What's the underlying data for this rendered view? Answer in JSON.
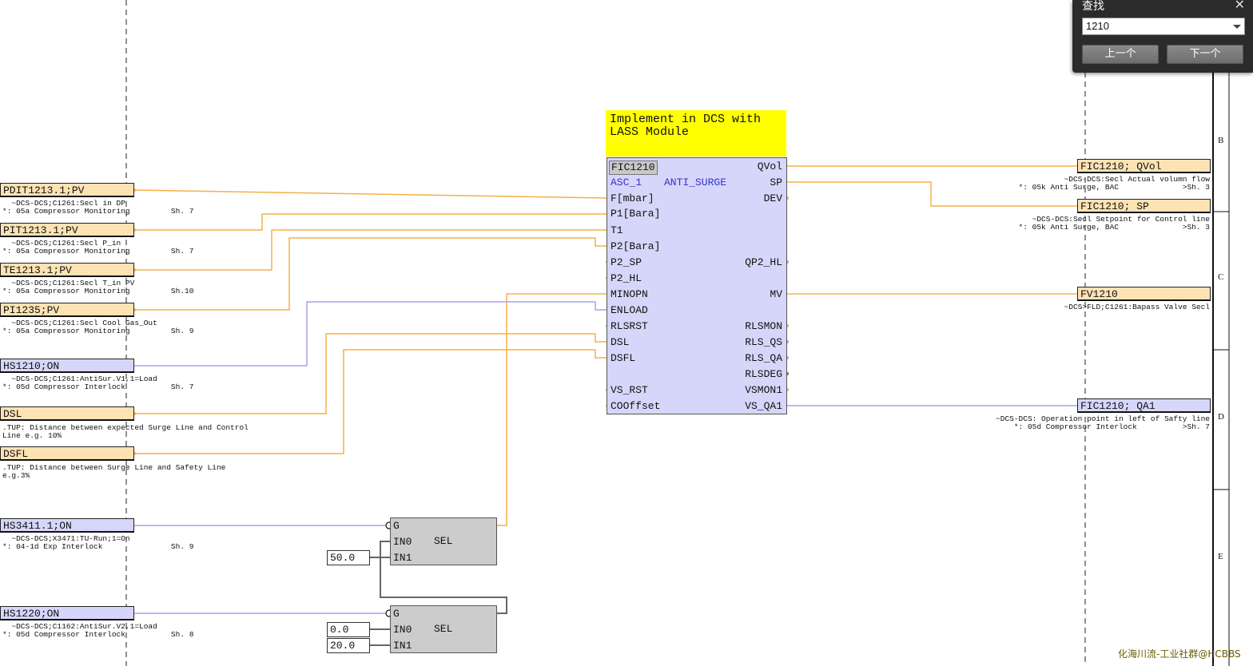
{
  "find_dialog": {
    "title": "查找",
    "close": "✕",
    "query": "1210",
    "prev_label": "上一个",
    "next_label": "下一个"
  },
  "annotation": "Implement in DCS with\nLASS Module",
  "function_block": {
    "tag": "FIC1210",
    "type": "ASC_1",
    "name": "ANTI_SURGE",
    "inputs": [
      "F[mbar]",
      "P1[Bara]",
      "T1",
      "P2[Bara]",
      "P2_SP",
      "P2_HL",
      "MINOPN",
      "ENLOAD",
      "RLSRST",
      "DSL",
      "DSFL",
      "",
      "VS_RST",
      "COOffset"
    ],
    "outputs": [
      "QVol",
      "SP",
      "DEV",
      "",
      "",
      "QP2_HL",
      "",
      "MV",
      "",
      "RLSMON",
      "RLS_QS",
      "RLS_QA",
      "RLSDEG",
      "VSMON1",
      "VS_QA1"
    ]
  },
  "left_signals": [
    {
      "tag": "PDIT1213.1;PV",
      "note": "  ~DCS-DCS;C1261:Secl in DP\n*: 05a Compressor Monitoring         Sh. 7"
    },
    {
      "tag": "PIT1213.1;PV",
      "note": "  ~DCS-DCS;C1261:Secl P_in\n*: 05a Compressor Monitoring         Sh. 7"
    },
    {
      "tag": "TE1213.1;PV",
      "note": "  ~DCS-DCS;C1261:Secl T_in PV\n*: 05a Compressor Monitoring         Sh.10"
    },
    {
      "tag": "PI1235;PV",
      "note": "  ~DCS-DCS;C1261:Secl Cool Gas_Out\n*: 05a Compressor Monitoring         Sh. 9"
    },
    {
      "tag": "HS1210;ON",
      "note": "  ~DCS-DCS;C1261:AntiSur.V1,1=Load\n*: 05d Compressor Interlock          Sh. 7"
    },
    {
      "tag": "DSL",
      "note": ".TUP: Distance between expected Surge Line and Control\nLine e.g. 10%"
    },
    {
      "tag": "DSFL",
      "note": ".TUP: Distance between Surge Line and Safety Line\ne.g.3%"
    },
    {
      "tag": "HS3411.1;ON",
      "note": "  ~DCS-DCS;X3471:TU-Run;1=On\n*: 04-1d Exp Interlock               Sh. 9"
    },
    {
      "tag": "HS1220;ON",
      "note": "  ~DCS-DCS;C1162:AntiSur.V2,1=Load\n*: 05d Compressor Interlock          Sh. 8"
    }
  ],
  "right_signals": [
    {
      "tag": "FIC1210; QVol",
      "note": "~DCS-DCS:Secl Actual volumn flow\n*: 05k Anti Surge, BAC              >Sh. 3"
    },
    {
      "tag": "FIC1210; SP",
      "note": "~DCS-DCS:Secl Setpoint for Control line\n*: 05k Anti Surge, BAC              >Sh. 3"
    },
    {
      "tag": "FV1210",
      "note": "~DCS>FLD;C1261:Bapass Valve Secl"
    },
    {
      "tag": "FIC1210; QA1",
      "note": "~DCS-DCS: Operation point in left of Safty line\n*: 05d Compressor Interlock          >Sh. 7"
    }
  ],
  "sel_blocks": [
    {
      "type": "SEL",
      "g": "G",
      "in0": "IN0",
      "in1": "IN1",
      "const_in0": "",
      "const_in1": "50.0"
    },
    {
      "type": "SEL",
      "g": "G",
      "in0": "IN0",
      "in1": "IN1",
      "const_in0": "0.0",
      "const_in1": "20.0"
    }
  ],
  "zones": [
    "B",
    "C",
    "D",
    "E"
  ],
  "watermark": "化海川流-工业社群@HCBBS",
  "colors": {
    "orange_wire": "#f5b04a",
    "purple_wire": "#a9a2e8",
    "block_fill": "#d6d6fa",
    "tag_fill": "#fde2b4",
    "annotation": "#ffff00"
  }
}
